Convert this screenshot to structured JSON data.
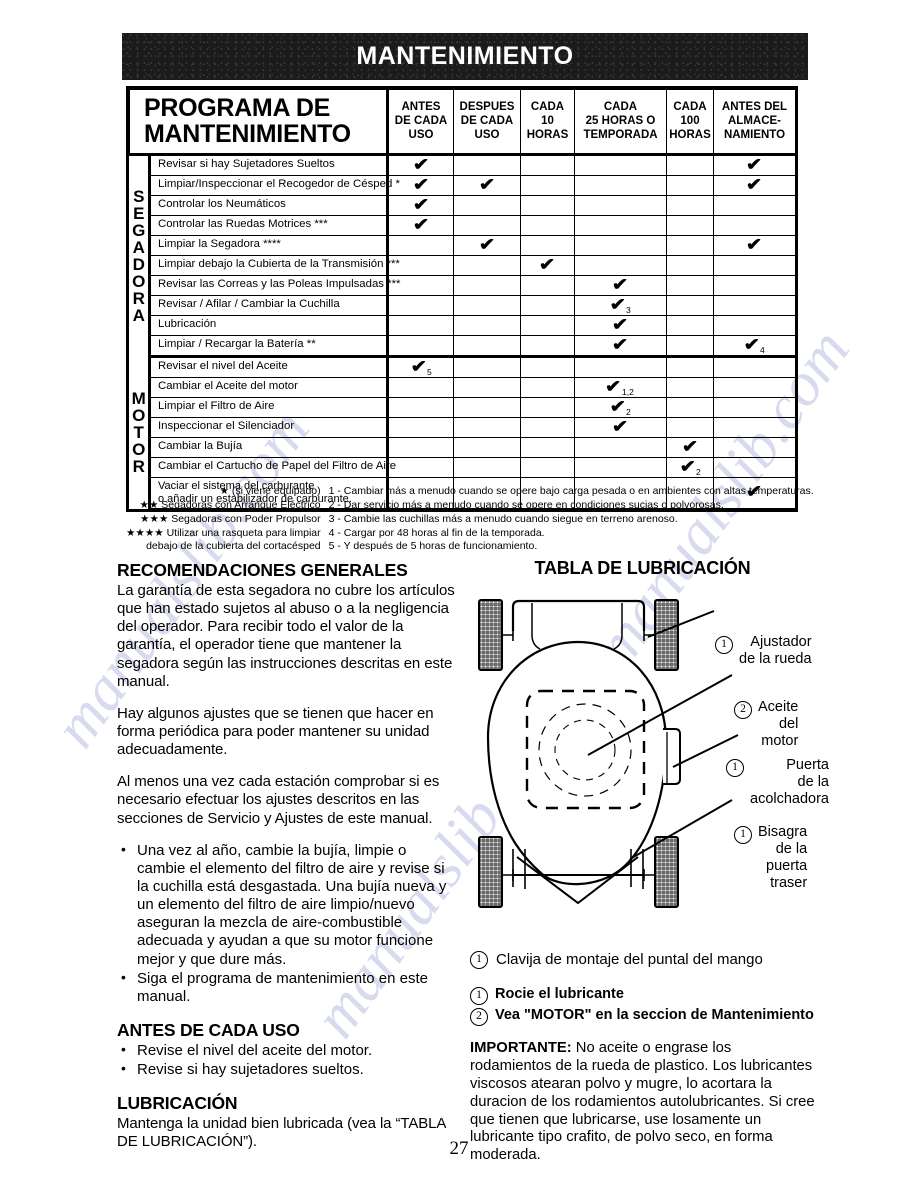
{
  "page": {
    "banner_title": "MANTENIMIENTO",
    "page_number": "27"
  },
  "schedule_table": {
    "title_line1": "PROGRAMA DE",
    "title_line2": "MANTENIMIENTO",
    "columns": [
      "ANTES\nDE CADA\nUSO",
      "DESPUES\nDE CADA\nUSO",
      "CADA\n10\nHORAS",
      "CADA\n25 HORAS O\nTEMPORADA",
      "CADA\n100\nHORAS",
      "ANTES DEL\nALMACE-\nNAMIENTO"
    ],
    "columns_flat": [
      "ANTES DE CADA USO",
      "DESPUES DE CADA USO",
      "CADA 10 HORAS",
      "CADA 25 HORAS O TEMPORADA",
      "CADA 100 HORAS",
      "ANTES DEL ALMACENAMIENTO"
    ],
    "groups": [
      {
        "label": "SEGADORA",
        "rows": [
          {
            "task": "Revisar si hay Sujetadores Sueltos",
            "marks": [
              "✔",
              "",
              "",
              "",
              "",
              "✔"
            ],
            "notes": [
              "",
              "",
              "",
              "",
              "",
              ""
            ]
          },
          {
            "task": "Limpiar/Inspeccionar el Recogedor de Césped *",
            "marks": [
              "✔",
              "✔",
              "",
              "",
              "",
              "✔"
            ],
            "notes": [
              "",
              "",
              "",
              "",
              "",
              ""
            ]
          },
          {
            "task": "Controlar los Neumáticos",
            "marks": [
              "✔",
              "",
              "",
              "",
              "",
              ""
            ],
            "notes": [
              "",
              "",
              "",
              "",
              "",
              ""
            ]
          },
          {
            "task": "Controlar las Ruedas Motrices ***",
            "marks": [
              "✔",
              "",
              "",
              "",
              "",
              ""
            ],
            "notes": [
              "",
              "",
              "",
              "",
              "",
              ""
            ]
          },
          {
            "task": "Limpiar la Segadora ****",
            "marks": [
              "",
              "✔",
              "",
              "",
              "",
              "✔"
            ],
            "notes": [
              "",
              "",
              "",
              "",
              "",
              ""
            ]
          },
          {
            "task": "Limpiar debajo la Cubierta de la Transmisión ***",
            "marks": [
              "",
              "",
              "✔",
              "",
              "",
              ""
            ],
            "notes": [
              "",
              "",
              "",
              "",
              "",
              ""
            ]
          },
          {
            "task": "Revisar las Correas y las Poleas Impulsadas ***",
            "marks": [
              "",
              "",
              "",
              "✔",
              "",
              ""
            ],
            "notes": [
              "",
              "",
              "",
              "",
              "",
              ""
            ]
          },
          {
            "task": "Revisar / Afilar / Cambiar la Cuchilla",
            "marks": [
              "",
              "",
              "",
              "✔",
              "",
              ""
            ],
            "notes": [
              "",
              "",
              "",
              "3",
              "",
              ""
            ]
          },
          {
            "task": "Lubricación",
            "marks": [
              "",
              "",
              "",
              "✔",
              "",
              ""
            ],
            "notes": [
              "",
              "",
              "",
              "",
              "",
              ""
            ]
          },
          {
            "task": "Limpiar / Recargar la Batería **",
            "marks": [
              "",
              "",
              "",
              "✔",
              "",
              "✔"
            ],
            "notes": [
              "",
              "",
              "",
              "",
              "",
              "4"
            ]
          }
        ]
      },
      {
        "label": "MOTOR",
        "rows": [
          {
            "task": "Revisar el nivel del Aceite",
            "marks": [
              "✔",
              "",
              "",
              "",
              "",
              ""
            ],
            "notes": [
              "5",
              "",
              "",
              "",
              "",
              ""
            ]
          },
          {
            "task": "Cambiar el Aceite del motor",
            "marks": [
              "",
              "",
              "",
              "✔",
              "",
              ""
            ],
            "notes": [
              "",
              "",
              "",
              "1,2",
              "",
              ""
            ]
          },
          {
            "task": "Limpiar el Filtro de Aire",
            "marks": [
              "",
              "",
              "",
              "✔",
              "",
              ""
            ],
            "notes": [
              "",
              "",
              "",
              "2",
              "",
              ""
            ]
          },
          {
            "task": "Inspeccionar el Silenciador",
            "marks": [
              "",
              "",
              "",
              "✔",
              "",
              ""
            ],
            "notes": [
              "",
              "",
              "",
              "",
              "",
              ""
            ]
          },
          {
            "task": "Cambiar la Bujía",
            "marks": [
              "",
              "",
              "",
              "",
              "✔",
              ""
            ],
            "notes": [
              "",
              "",
              "",
              "",
              "",
              ""
            ]
          },
          {
            "task": "Cambiar el Cartucho de Papel del Filtro de Aire",
            "marks": [
              "",
              "",
              "",
              "",
              "✔",
              ""
            ],
            "notes": [
              "",
              "",
              "",
              "",
              "2",
              ""
            ]
          },
          {
            "task": "Vaciar el sistema del carburante\no añadir un estabilizador de carburante.",
            "marks": [
              "",
              "",
              "",
              "",
              "",
              "✔"
            ],
            "notes": [
              "",
              "",
              "",
              "",
              "",
              ""
            ]
          }
        ]
      }
    ]
  },
  "footnotes": {
    "left": [
      "★ (si viene equipado)",
      "★★ Segadoras con Arranque Eléctrico",
      "★★★ Segadoras con Poder Propulsor",
      "★★★★ Utilizar una rasqueta para limpiar",
      "debajo de la cubierta del cortacésped"
    ],
    "right": [
      "1 - Cambiar más a menudo cuando se opere bajo carga pesada o en ambientes con altas temperaturas.",
      "2 - Dar servicio más a menudo cuando se opere en condiciones sucias o polvorosas.",
      "3 - Cambie las cuchillas más a menudo cuando siegue en terreno arenoso.",
      "4 - Cargar por 48 horas al fin de la temporada.",
      "5 - Y después de 5 horas de funcionamiento."
    ]
  },
  "recommendations": {
    "heading": "RECOMENDACIONES GENERALES",
    "paragraphs": [
      "La garantía de esta segadora no cubre los artículos que han estado sujetos al abuso o a la negligencia del operador. Para recibir todo el valor de la garantía, el operador tiene que mantener la segadora según las instrucciones descritas en este manual.",
      "Hay algunos ajustes que se tienen que hacer en forma periódica para poder mantener su unidad adecuadamente.",
      "Al menos una vez cada estación comprobar si es necesario efectuar los ajustes descritos en las secciones de Servicio y Ajustes de este manual."
    ],
    "bullets": [
      "Una vez al año, cambie la bujía, limpie o cambie el elemento del filtro de aire y revise si la cuchilla está desgastada. Una bujía nueva y un elemento del filtro de aire limpio/nuevo aseguran la mezcla de aire-combustible adecuada y ayudan a que su motor funcione mejor y que dure más.",
      "Siga el programa de mantenimiento en este manual."
    ]
  },
  "before_each_use": {
    "heading": "ANTES DE CADA USO",
    "bullets": [
      "Revise el nivel del aceite del motor.",
      "Revise si hay sujetadores sueltos."
    ]
  },
  "lubrication_note": {
    "heading": "LUBRICACIÓN",
    "text": "Mantenga la unidad bien lubricada (vea la “TABLA DE LUBRICACIÓN”)."
  },
  "lubrication_chart": {
    "heading": "TABLA DE LUBRICACIÓN",
    "callouts": [
      {
        "num": "1",
        "lines": [
          "Ajustador",
          "de la rueda"
        ]
      },
      {
        "num": "2",
        "lines": [
          "Aceite",
          "del",
          "motor"
        ]
      },
      {
        "num": "1",
        "lines": [
          "Puerta",
          "de la",
          "acolchadora"
        ]
      },
      {
        "num": "1",
        "lines": [
          "Bisagra",
          "de la",
          "puerta",
          "traser"
        ]
      }
    ],
    "pin_caption": {
      "num": "1",
      "text": "Clavija de montaje del puntal del mango"
    },
    "legend": [
      {
        "num": "1",
        "text": "Rocie el lubricante"
      },
      {
        "num": "2",
        "text": "Vea \"MOTOR\" en la seccion de Mantenimiento"
      }
    ]
  },
  "important_note": {
    "label": "IMPORTANTE:",
    "text": " No aceite o engrase los rodamientos de la rueda de plastico. Los lubricantes viscosos atearan polvo y mugre, lo acortara la duracion de los rodamientos autolubricantes. Si cree que tienen que lubricarse, use losamente un lubricante tipo crafito, de polvo seco, en forma moderada."
  },
  "watermark": {
    "text": "manualslib.com"
  }
}
